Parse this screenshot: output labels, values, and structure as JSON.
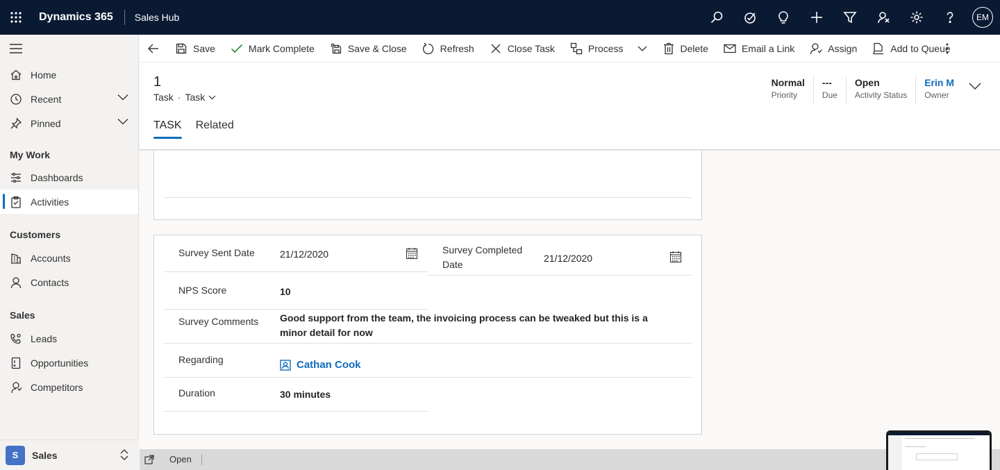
{
  "topbar": {
    "app_name": "Dynamics 365",
    "area_name": "Sales Hub",
    "user_initials": "EM",
    "icons": [
      "search-icon",
      "task-check-icon",
      "lightbulb-icon",
      "plus-icon",
      "filter-icon",
      "assistant-icon",
      "gear-icon",
      "help-icon"
    ]
  },
  "sidebar": {
    "items_top": [
      {
        "label": "Home",
        "icon": "home-icon"
      },
      {
        "label": "Recent",
        "icon": "clock-icon",
        "expandable": true
      },
      {
        "label": "Pinned",
        "icon": "pin-icon",
        "expandable": true
      }
    ],
    "sections": [
      {
        "title": "My Work",
        "items": [
          {
            "label": "Dashboards",
            "icon": "dashboard-icon"
          },
          {
            "label": "Activities",
            "icon": "clipboard-icon",
            "active": true
          }
        ]
      },
      {
        "title": "Customers",
        "items": [
          {
            "label": "Accounts",
            "icon": "building-icon"
          },
          {
            "label": "Contacts",
            "icon": "person-icon"
          }
        ]
      },
      {
        "title": "Sales",
        "items": [
          {
            "label": "Leads",
            "icon": "phone-person-icon"
          },
          {
            "label": "Opportunities",
            "icon": "document-icon"
          },
          {
            "label": "Competitors",
            "icon": "competitor-icon"
          }
        ]
      }
    ],
    "area": {
      "badge": "S",
      "label": "Sales"
    }
  },
  "commandbar": {
    "save": "Save",
    "mark_complete": "Mark Complete",
    "save_close": "Save & Close",
    "refresh": "Refresh",
    "close_task": "Close Task",
    "process": "Process",
    "delete": "Delete",
    "email_link": "Email a Link",
    "assign": "Assign",
    "add_queue": "Add to Queue"
  },
  "header": {
    "title": "1",
    "entity": "Task",
    "form": "Task",
    "fields": {
      "priority_value": "Normal",
      "priority_label": "Priority",
      "due_value": "---",
      "due_label": "Due",
      "status_value": "Open",
      "status_label": "Activity Status",
      "owner_value": "Erin M",
      "owner_label": "Owner"
    },
    "tabs": [
      "TASK",
      "Related"
    ]
  },
  "form": {
    "survey_sent_label": "Survey Sent Date",
    "survey_sent_value": "21/12/2020",
    "survey_completed_label_1": "Survey Completed",
    "survey_completed_label_2": "Date",
    "survey_completed_value": "21/12/2020",
    "nps_label": "NPS Score",
    "nps_value": "10",
    "comments_label": "Survey Comments",
    "comments_line1": "Good support from the team, the invoicing process can be tweaked but this is a",
    "comments_line2": "minor detail for now",
    "regarding_label": "Regarding",
    "regarding_value": "Cathan Cook",
    "duration_label": "Duration",
    "duration_value": "30 minutes"
  },
  "statusbar": {
    "status": "Open"
  },
  "colors": {
    "topbar": "#0b1a33",
    "accent": "#0f6cbd",
    "area_badge": "#4473c5"
  }
}
